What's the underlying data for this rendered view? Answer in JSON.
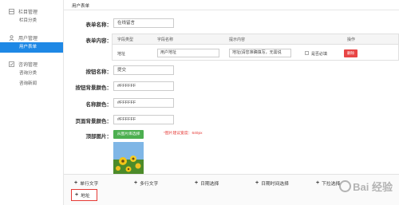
{
  "sidebar": {
    "sections": [
      {
        "title": "栏目管理",
        "icon": "grid-icon",
        "items": [
          {
            "label": "栏目分类",
            "active": false
          }
        ]
      },
      {
        "title": "用户管理",
        "icon": "user-icon",
        "items": [
          {
            "label": "用户表单",
            "active": true
          }
        ]
      },
      {
        "title": "咨询管理",
        "icon": "check-icon",
        "items": [
          {
            "label": "咨询分类",
            "active": false
          },
          {
            "label": "咨询新闻",
            "active": false
          }
        ]
      }
    ]
  },
  "page": {
    "title": "用户表单"
  },
  "form": {
    "name_label": "表单名称：",
    "name_value": "在线留言",
    "content_label": "表单内容：",
    "table": {
      "headers": [
        "字段类型",
        "字段名称",
        "提示内容",
        "",
        "操作"
      ],
      "row": {
        "type": "地址",
        "name": "用户地址",
        "hint": "地址(请您准确填写，无需说",
        "required_label": "是否必填",
        "delete_label": "删除"
      }
    },
    "button_name_label": "按钮名称：",
    "button_name_value": "提交",
    "button_bg_label": "按钮背景颜色：",
    "button_bg_value": "#FFFFFF",
    "name_color_label": "名称颜色：",
    "name_color_value": "#FFFFFF",
    "page_bg_label": "页面背景颜色：",
    "page_bg_value": "#FFFFFF",
    "top_image_label": "顶部图片：",
    "upload_label": "从图片库选择",
    "upload_hint": "*图片建议宽度：640px"
  },
  "field_types": [
    {
      "label": "单行文字",
      "selected": false
    },
    {
      "label": "多行文字",
      "selected": false
    },
    {
      "label": "日期选择",
      "selected": false
    },
    {
      "label": "日期时间选择",
      "selected": false
    },
    {
      "label": "下拉选择",
      "selected": false
    },
    {
      "label": "地址",
      "selected": true
    }
  ],
  "watermark": {
    "text": "Bai 经验"
  },
  "colors": {
    "accent": "#1e88e5",
    "danger": "#e84545",
    "success": "#4caf50"
  }
}
